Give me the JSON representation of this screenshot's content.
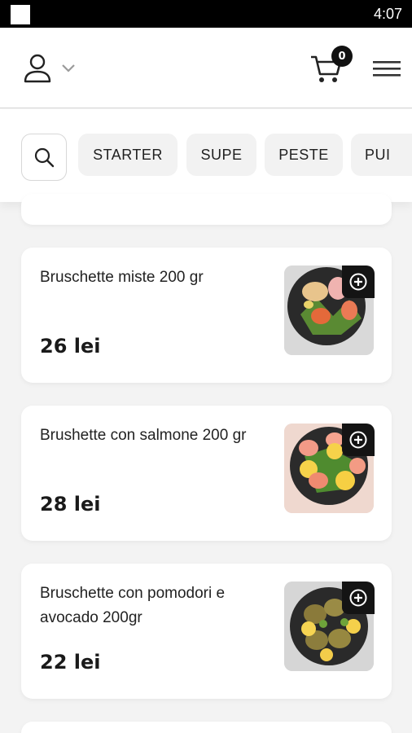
{
  "status_bar": {
    "time": "4:07"
  },
  "header": {
    "cart_count": "0",
    "icons": {
      "user": "user-icon",
      "chevron": "chevron-down-icon",
      "cart": "cart-icon",
      "menu": "hamburger-menu-icon"
    }
  },
  "categories": {
    "search_icon": "search-icon",
    "items": [
      "STARTER",
      "SUPE",
      "PESTE",
      "PUI"
    ]
  },
  "products": [
    {
      "name": "Bruschette miste 200 gr",
      "price": "26 lei"
    },
    {
      "name": "Brushette con salmone 200 gr",
      "price": "28 lei"
    },
    {
      "name": "Bruschette con pomodori e avocado 200gr",
      "price": "22 lei"
    }
  ],
  "colors": {
    "accent": "#141414",
    "background": "#f3f3f3",
    "card": "#ffffff",
    "chip": "#f2f2f2"
  }
}
